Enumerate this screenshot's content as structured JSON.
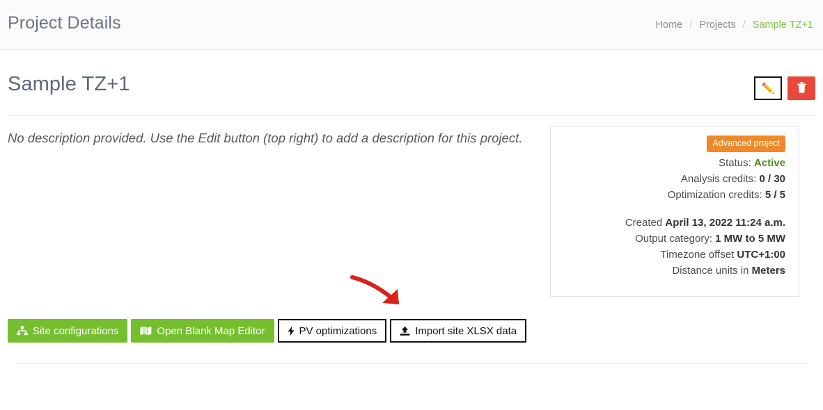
{
  "header": {
    "title": "Project Details",
    "breadcrumb": [
      {
        "label": "Home",
        "active": false
      },
      {
        "label": "Projects",
        "active": false
      },
      {
        "label": "Sample TZ+1",
        "active": true
      }
    ],
    "separator": "/"
  },
  "project": {
    "title": "Sample TZ+1",
    "description": "No description provided. Use the Edit button (top right) to add a description for this project.",
    "edit_button": {
      "icon": "pencil-icon",
      "glyph": "✏️",
      "label": ""
    },
    "delete_button": {
      "icon": "trash-icon",
      "label": ""
    }
  },
  "info_panel": {
    "badge": "Advanced project",
    "rows": [
      {
        "label": "Status:",
        "value": "Active",
        "style": "green"
      },
      {
        "label": "Analysis credits:",
        "value": "0 / 30",
        "style": "bold"
      },
      {
        "label": "Optimization credits:",
        "value": "5 / 5",
        "style": "bold"
      },
      {
        "label": "Created",
        "value": "April 13, 2022 11:24 a.m.",
        "style": "bold"
      },
      {
        "label": "Output category:",
        "value": "1 MW to 5 MW",
        "style": "bold"
      },
      {
        "label": "Timezone offset",
        "value": "UTC+1:00",
        "style": "bold"
      },
      {
        "label": "Distance units in",
        "value": "Meters",
        "style": "bold"
      }
    ]
  },
  "actions": [
    {
      "label": "Site configurations",
      "icon": "sitemap-icon",
      "variant": "green"
    },
    {
      "label": "Open Blank Map Editor",
      "icon": "map-icon",
      "variant": "green"
    },
    {
      "label": "PV optimizations",
      "icon": "bolt-icon",
      "variant": "white"
    },
    {
      "label": "Import site XLSX data",
      "icon": "upload-icon",
      "variant": "white"
    }
  ],
  "annotation": {
    "type": "arrow",
    "color": "#d8221c",
    "points_to": "Import site XLSX data"
  },
  "colors": {
    "green": "#75bf2f",
    "red": "#e8493c",
    "orange": "#f0892a",
    "breadcrumb_active": "#7cc143",
    "status_green": "#4a8a20",
    "annotation_red": "#d8221c"
  }
}
